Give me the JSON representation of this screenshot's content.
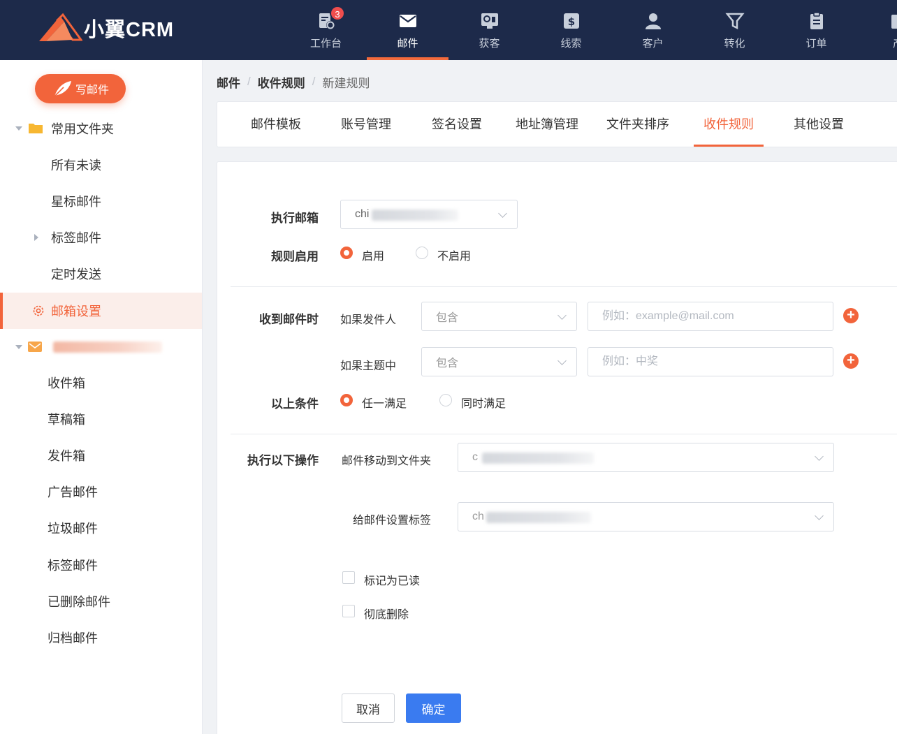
{
  "app": {
    "logo_text": "小翼CRM"
  },
  "nav": [
    {
      "label": "工作台",
      "icon": "workbench-icon",
      "badge": "3"
    },
    {
      "label": "邮件",
      "icon": "mail-icon",
      "active": true
    },
    {
      "label": "获客",
      "icon": "acquire-icon"
    },
    {
      "label": "线索",
      "icon": "leads-icon"
    },
    {
      "label": "客户",
      "icon": "customer-icon"
    },
    {
      "label": "转化",
      "icon": "funnel-icon"
    },
    {
      "label": "订单",
      "icon": "order-icon"
    },
    {
      "label": "产",
      "icon": "product-icon"
    }
  ],
  "sidebar": {
    "write_label": "写邮件",
    "common_folder": "常用文件夹",
    "items": [
      "所有未读",
      "星标邮件",
      "标签邮件",
      "定时发送"
    ],
    "settings_label": "邮箱设置",
    "mailbox_items": [
      "收件箱",
      "草稿箱",
      "发件箱",
      "广告邮件",
      "垃圾邮件",
      "标签邮件",
      "已删除邮件",
      "归档邮件"
    ]
  },
  "breadcrumb": {
    "level1": "邮件",
    "level2": "收件规则",
    "current": "新建规则",
    "sep": "/"
  },
  "tabs": [
    "邮件模板",
    "账号管理",
    "签名设置",
    "地址簿管理",
    "文件夹排序",
    "收件规则",
    "其他设置"
  ],
  "form": {
    "exec_mailbox_label": "执行邮箱",
    "exec_mailbox_value": "chi",
    "rule_enable_label": "规则启用",
    "enable_on": "启用",
    "enable_off": "不启用",
    "on_receive_label": "收到邮件时",
    "if_sender_label": "如果发件人",
    "sender_op": "包含",
    "sender_placeholder": "例如：example@mail.com",
    "if_subject_label": "如果主题中",
    "subject_op": "包含",
    "subject_placeholder": "例如：中奖",
    "conditions_label": "以上条件",
    "cond_any": "任一满足",
    "cond_all": "同时满足",
    "actions_label": "执行以下操作",
    "move_label": "邮件移动到文件夹",
    "move_value": "c",
    "tag_label": "给邮件设置标签",
    "tag_value": "ch",
    "mark_read": "标记为已读",
    "delete_forever": "彻底删除",
    "plus_symbol": "+",
    "cancel": "取消",
    "confirm": "确定"
  },
  "colors": {
    "accent": "#f2643b",
    "primary": "#3a7bf0",
    "nav_bg": "#1d2a4a"
  }
}
